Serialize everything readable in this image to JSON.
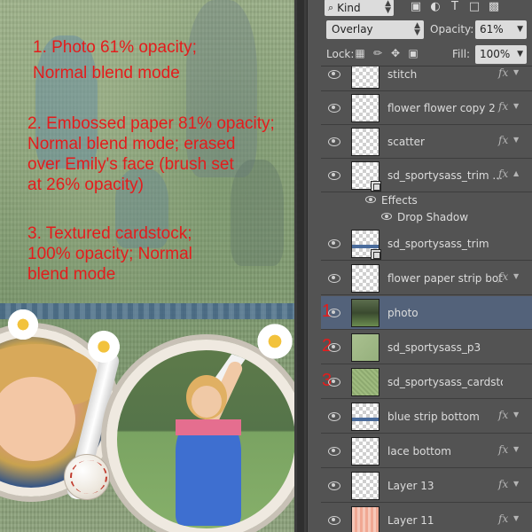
{
  "annotations": {
    "line1a": "1. Photo 61% opacity;",
    "line1b": "Normal blend mode",
    "line2": "2. Embossed paper 81% opacity;\nNormal blend mode; erased\nover Emily's face (brush set\nat 26% opacity)",
    "line3": "3. Textured cardstock;\n100% opacity; Normal\nblend mode"
  },
  "layers_panel": {
    "filter": {
      "kind_label": "Kind",
      "icons": [
        "image-filter-icon",
        "adjustment-filter-icon",
        "type-filter-icon",
        "shape-filter-icon",
        "smart-object-filter-icon"
      ]
    },
    "blend_mode": "Overlay",
    "opacity_label": "Opacity:",
    "opacity_value": "61%",
    "lock_label": "Lock:",
    "fill_label": "Fill:",
    "fill_value": "100%",
    "layers": [
      {
        "name": "stitch",
        "fx": "fx",
        "visible": true
      },
      {
        "name": "flower flower  copy 2",
        "fx": "fx",
        "visible": true
      },
      {
        "name": "scatter",
        "fx": "fx",
        "visible": true
      },
      {
        "name": "sd_sportysass_trim ...",
        "fx": "fx",
        "visible": true,
        "effects": [
          "Effects",
          "Drop Shadow"
        ]
      },
      {
        "name": "sd_sportysass_trim",
        "visible": true
      },
      {
        "name": "flower paper strip bot",
        "fx": "fx",
        "visible": true
      },
      {
        "name": "photo",
        "visible": true,
        "selected": true,
        "marker": "1"
      },
      {
        "name": "sd_sportysass_p3",
        "visible": true,
        "marker": "2"
      },
      {
        "name": "sd_sportysass_cardsto...",
        "visible": true,
        "marker": "3"
      },
      {
        "name": "blue strip bottom",
        "fx": "fx",
        "visible": true
      },
      {
        "name": "lace bottom",
        "fx": "fx",
        "visible": true
      },
      {
        "name": "Layer 13",
        "fx": "fx",
        "visible": true
      },
      {
        "name": "Layer 11",
        "fx": "fx",
        "visible": true
      }
    ]
  },
  "colors": {
    "annotation": "#e41c1c",
    "selected_layer": "#53627a",
    "panel_bg": "#535353"
  }
}
